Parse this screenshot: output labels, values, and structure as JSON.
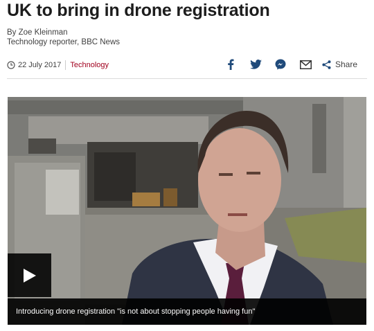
{
  "article": {
    "headline": "UK to bring in drone registration",
    "author": "By Zoe Kleinman",
    "author_role": "Technology reporter, BBC News",
    "date": "22 July 2017",
    "topic": "Technology"
  },
  "share": {
    "label": "Share",
    "icons": [
      "facebook-icon",
      "twitter-icon",
      "messenger-icon",
      "email-icon",
      "share-icon"
    ]
  },
  "media": {
    "caption": "Introducing drone registration \"is not about stopping people having fun\"",
    "play_icon": "play-icon"
  },
  "colors": {
    "headline": "#1d1d1d",
    "topic_link": "#a1001e",
    "share_icon": "#1f4a7a",
    "caption_bg": "#000000"
  }
}
